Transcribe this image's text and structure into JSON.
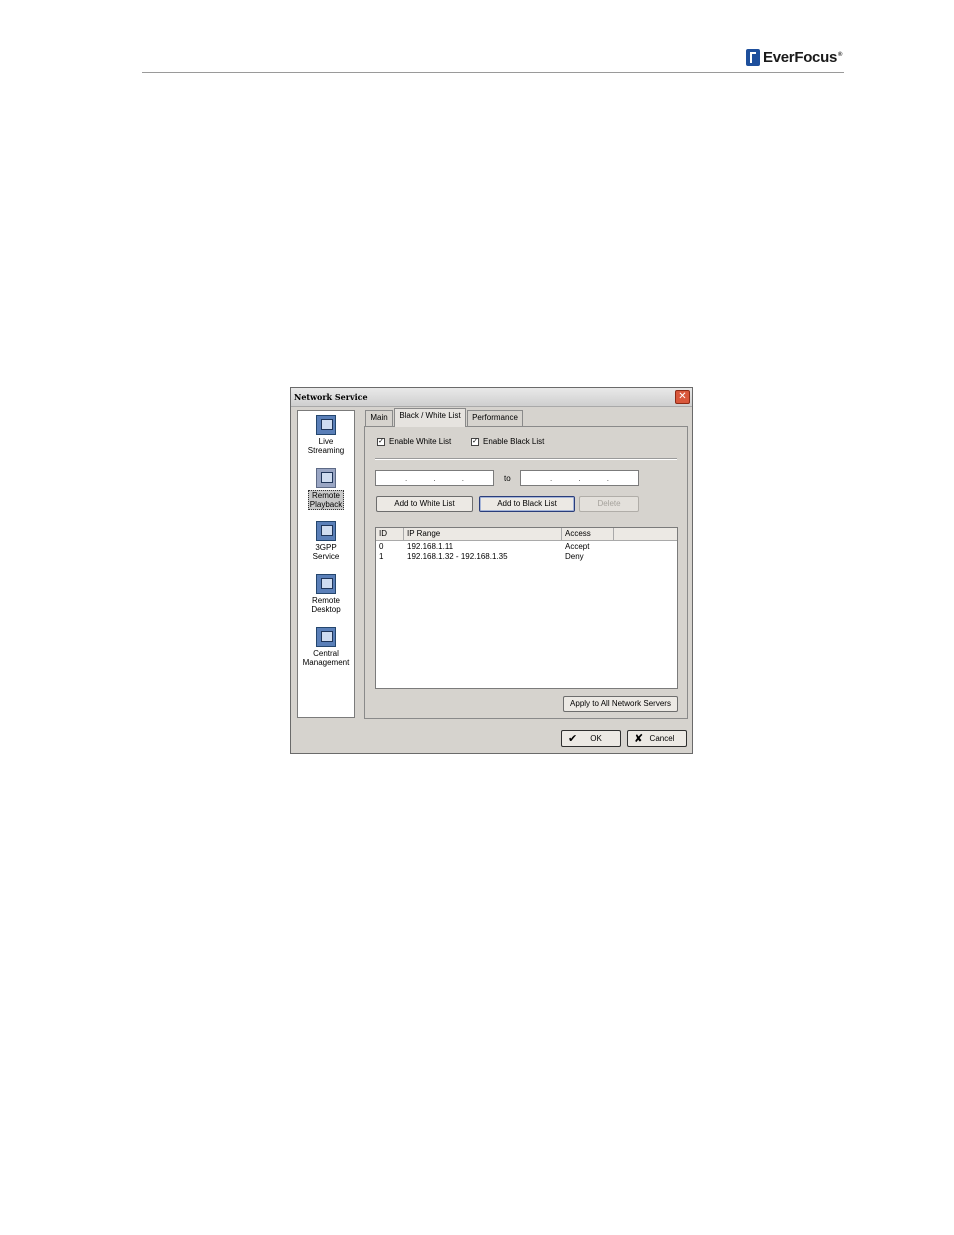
{
  "brand": {
    "logo_text": "EverFocus",
    "registered": "®"
  },
  "dialog": {
    "title": "Network Service",
    "close_symbol": "✕",
    "sidebar": [
      {
        "label_line1": "Live",
        "label_line2": "Streaming",
        "icon": "monitor-icon",
        "selected": false
      },
      {
        "label_line1": "Remote",
        "label_line2": "Playback",
        "icon": "playback-icon",
        "selected": true
      },
      {
        "label_line1": "3GPP",
        "label_line2": "Service",
        "icon": "phone-icon",
        "selected": false
      },
      {
        "label_line1": "Remote",
        "label_line2": "Desktop",
        "icon": "desktop-icon",
        "selected": false
      },
      {
        "label_line1": "Central",
        "label_line2": "Management",
        "icon": "management-icon",
        "selected": false
      }
    ],
    "tabs": [
      {
        "label": "Main"
      },
      {
        "label": "Black / White List"
      },
      {
        "label": "Performance"
      }
    ],
    "white_list": {
      "label": "Enable White List",
      "checked": true,
      "mark": "✓"
    },
    "black_list": {
      "label": "Enable Black List",
      "checked": true,
      "mark": "✓"
    },
    "ip_from": {
      "dots": [
        ".",
        ".",
        "."
      ]
    },
    "to_label": "to",
    "ip_to": {
      "dots": [
        ".",
        ".",
        "."
      ]
    },
    "buttons": {
      "add_white": "Add to White List",
      "add_black": "Add to Black List",
      "delete": "Delete",
      "apply_all": "Apply to All Network Servers",
      "ok": "OK",
      "ok_icon": "✔",
      "cancel": "Cancel",
      "cancel_icon": "✘"
    },
    "table": {
      "columns": [
        "ID",
        "IP Range",
        "Access"
      ],
      "rows": [
        {
          "id": "0",
          "ip_range": "192.168.1.11",
          "access": "Accept"
        },
        {
          "id": "1",
          "ip_range": "192.168.1.32 - 192.168.1.35",
          "access": "Deny"
        }
      ]
    }
  }
}
